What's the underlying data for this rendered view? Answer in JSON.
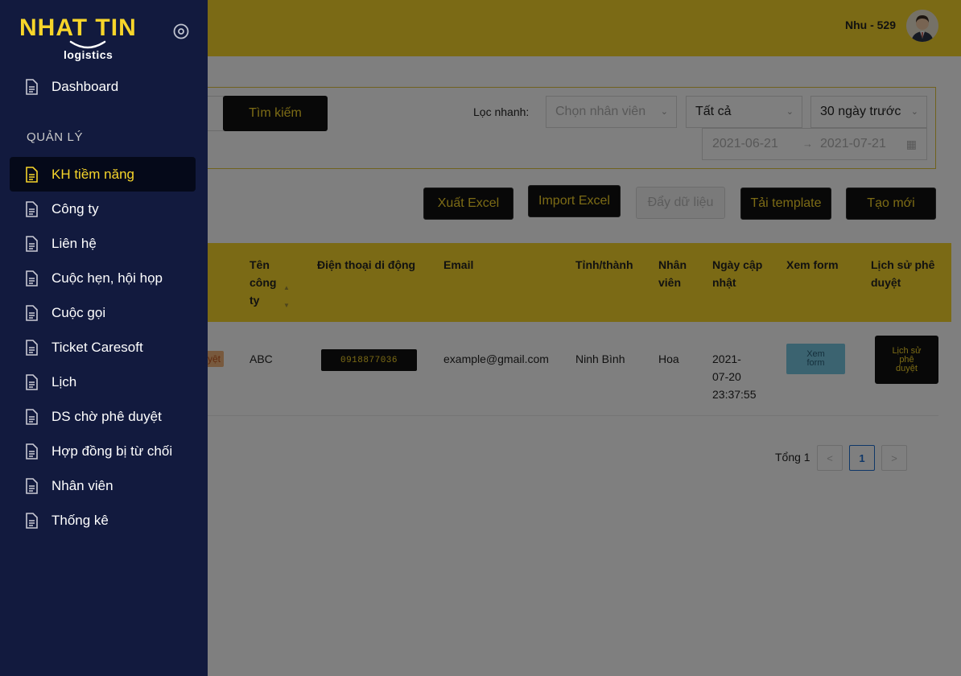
{
  "brand": {
    "name_top": "NHAT TIN",
    "name_bottom": "logistics"
  },
  "header": {
    "user_name": "Nhu - 529"
  },
  "sidebar": {
    "dashboard": "Dashboard",
    "section": "QUẢN LÝ",
    "items": [
      {
        "label": "KH tiềm năng",
        "active": true
      },
      {
        "label": "Công ty"
      },
      {
        "label": "Liên hệ"
      },
      {
        "label": "Cuộc hẹn, hội họp"
      },
      {
        "label": "Cuộc gọi"
      },
      {
        "label": "Ticket Caresoft"
      },
      {
        "label": "Lịch"
      },
      {
        "label": "DS chờ phê duyệt"
      },
      {
        "label": "Hợp đồng bị từ chối"
      },
      {
        "label": "Nhân viên"
      },
      {
        "label": "Thống kê"
      }
    ]
  },
  "filters": {
    "search_button": "Tìm kiếm",
    "quick_label": "Lọc nhanh:",
    "employee_placeholder": "Chọn nhân viên",
    "status_value": "Tất cả",
    "period_value": "30 ngày trước",
    "date_from": "2021-06-21",
    "date_to": "2021-07-21"
  },
  "actions": {
    "export": "Xuất Excel",
    "import": "Import Excel",
    "push": "Đẩy dữ liệu",
    "template": "Tải template",
    "create": "Tạo mới"
  },
  "table": {
    "headers": {
      "company": "Tên công ty",
      "phone": "Điện thoại di động",
      "email": "Email",
      "province": "Tỉnh/thành",
      "employee": "Nhân viên",
      "updated": "Ngày cập nhật",
      "form": "Xem form",
      "history": "Lịch sử phê duyệt"
    },
    "rows": [
      {
        "status": "uyệt",
        "company": "ABC",
        "phone": "0918877036",
        "email": "example@gmail.com",
        "province": "Ninh Bình",
        "employee": "Hoa",
        "updated_date": "2021-",
        "updated_date2": "07-20",
        "updated_time": "23:37:55",
        "form_button": "Xem form",
        "history_button": "Lịch sử phê duyệt"
      }
    ]
  },
  "pagination": {
    "total": "Tổng 1",
    "current": "1",
    "prev": "<",
    "next": ">"
  },
  "colors": {
    "accent": "#f7d52a",
    "sidebar": "#121a3e",
    "dark": "#111111"
  }
}
